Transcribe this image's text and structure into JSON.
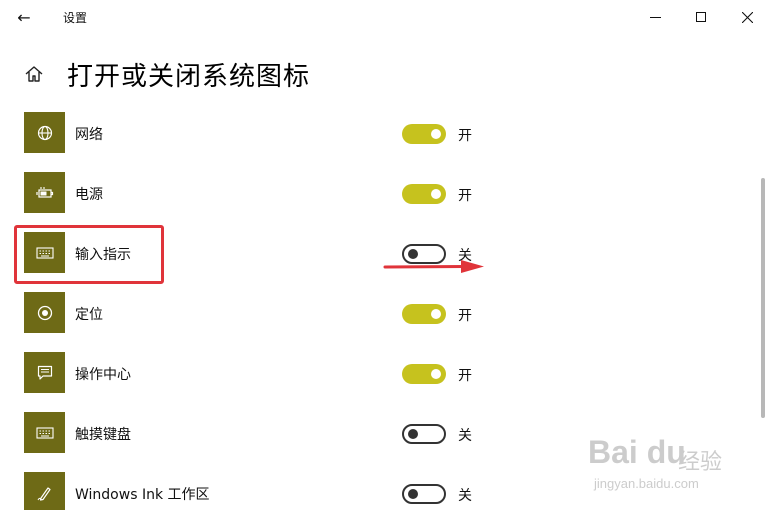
{
  "window": {
    "title": "设置",
    "back_icon": "←"
  },
  "page": {
    "title": "打开或关闭系统图标"
  },
  "rows": [
    {
      "label": "网络",
      "state": "开",
      "on": true,
      "icon": "globe-icon"
    },
    {
      "label": "电源",
      "state": "开",
      "on": true,
      "icon": "battery-icon"
    },
    {
      "label": "输入指示",
      "state": "关",
      "on": false,
      "icon": "keyboard-icon"
    },
    {
      "label": "定位",
      "state": "开",
      "on": true,
      "icon": "location-icon"
    },
    {
      "label": "操作中心",
      "state": "开",
      "on": true,
      "icon": "action-center-icon"
    },
    {
      "label": "触摸键盘",
      "state": "关",
      "on": false,
      "icon": "touch-keyboard-icon"
    },
    {
      "label": "Windows Ink 工作区",
      "state": "关",
      "on": false,
      "icon": "pen-icon"
    }
  ],
  "annotations": {
    "highlight_color": "#e0343a"
  },
  "watermark": {
    "logo": "Bai du",
    "text": "经验",
    "url": "jingyan.baidu.com"
  },
  "colors": {
    "accent": "#c6c21e",
    "icon_tile": "#6e6a16"
  }
}
